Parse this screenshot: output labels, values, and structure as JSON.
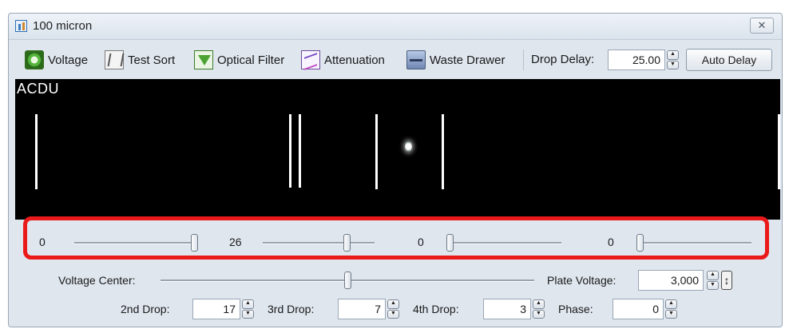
{
  "window": {
    "title": "100 micron",
    "close_label": "✕"
  },
  "toolbar": {
    "items": [
      {
        "label": "Voltage",
        "icon": "voltage-icon"
      },
      {
        "label": "Test Sort",
        "icon": "test-sort-icon"
      },
      {
        "label": "Optical Filter",
        "icon": "optical-filter-icon"
      },
      {
        "label": "Attenuation",
        "icon": "attenuation-icon"
      },
      {
        "label": "Waste Drawer",
        "icon": "waste-drawer-icon"
      }
    ],
    "drop_delay_label": "Drop Delay:",
    "drop_delay_value": "25.00",
    "auto_delay_label": "Auto Delay"
  },
  "scope": {
    "label": "ACDU",
    "drop_lines": 6,
    "droplet_visible": true
  },
  "sliders": [
    {
      "value": "0",
      "level": 1.0
    },
    {
      "value": "26",
      "level": 0.75
    },
    {
      "value": "0",
      "level": 0.0
    },
    {
      "value": "0",
      "level": 0.0
    }
  ],
  "voltage_center": {
    "label": "Voltage Center:",
    "level": 0.5
  },
  "plate_voltage": {
    "label": "Plate Voltage:",
    "value": "3,000",
    "pin_icon": "pin-icon"
  },
  "drops": [
    {
      "label": "2nd Drop:",
      "value": "17"
    },
    {
      "label": "3rd Drop:",
      "value": "7"
    },
    {
      "label": "4th Drop:",
      "value": "3"
    },
    {
      "label": "Phase:",
      "value": "0"
    }
  ],
  "colors": {
    "highlight": "#ea1a1a",
    "scope_bg": "#000000",
    "window_bg": "#dfe6ee"
  }
}
